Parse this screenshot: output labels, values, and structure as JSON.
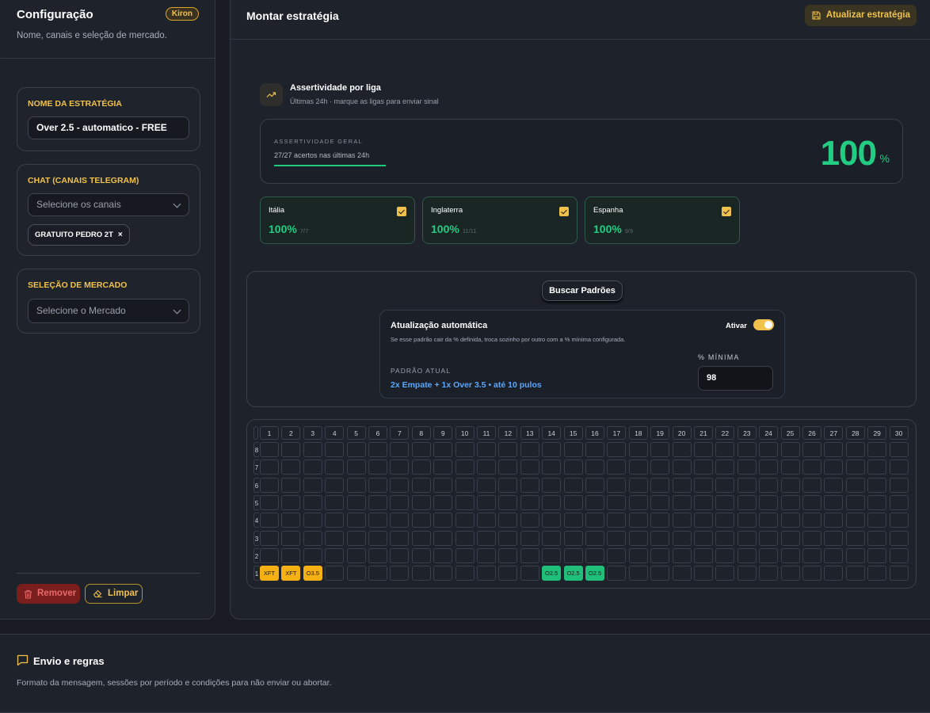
{
  "left": {
    "title": "Configuração",
    "badge": "Kiron",
    "subtitle": "Nome, canais e seleção de mercado.",
    "strategy_name": {
      "label": "NOME DA ESTRATÉGIA",
      "value": "Over 2.5 - automatico - FREE"
    },
    "chat": {
      "label": "CHAT (CANAIS TELEGRAM)",
      "placeholder": "Selecione os canais",
      "chip": "GRATUITO PEDRO 2T",
      "chip_remove": "×"
    },
    "market": {
      "label": "SELEÇÃO DE MERCADO",
      "placeholder": "Selecione o Mercado"
    },
    "remove_label": "Remover",
    "clear_label": "Limpar"
  },
  "right": {
    "title": "Montar estratégia",
    "update_label": "Atualizar estratégia",
    "assertivity": {
      "title": "Assertividade por liga",
      "subtitle": "Últimas 24h · marque as ligas para enviar sinal",
      "overall_label": "ASSERTIVIDADE GERAL",
      "overall_sub": "27/27 acertos nas últimas 24h",
      "overall_value": "100",
      "overall_unit": "%",
      "overall_progress": 1.0
    },
    "leagues": [
      {
        "name": "Itália",
        "pct": "100%",
        "count": "7/7",
        "checked": true
      },
      {
        "name": "Inglaterra",
        "pct": "100%",
        "count": "11/11",
        "checked": true
      },
      {
        "name": "Espanha",
        "pct": "100%",
        "count": "9/9",
        "checked": true
      }
    ],
    "search_label": "Buscar Padrões",
    "auto_update": {
      "title": "Atualização automática",
      "description": "Se esse padrão cair da % definida, troca sozinho por outro com a % mínima configurada.",
      "toggle_label": "Ativar",
      "enabled": true,
      "current_label": "PADRÃO ATUAL",
      "current_value": "2x Empate + 1x Over 3.5 • até 10 pulos",
      "min_label": "% MÍNIMA",
      "min_value": "98"
    },
    "grid": {
      "columns": [
        "1",
        "2",
        "3",
        "4",
        "5",
        "6",
        "7",
        "8",
        "9",
        "10",
        "11",
        "12",
        "13",
        "14",
        "15",
        "16",
        "17",
        "18",
        "19",
        "20",
        "21",
        "22",
        "23",
        "24",
        "25",
        "26",
        "27",
        "28",
        "29",
        "30"
      ],
      "rows": [
        "8",
        "7",
        "6",
        "5",
        "4",
        "3",
        "2",
        "1"
      ],
      "marks": [
        {
          "row": "1",
          "col": "1",
          "text": "XFT",
          "color": "#f5b014"
        },
        {
          "row": "1",
          "col": "2",
          "text": "XFT",
          "color": "#f5b014"
        },
        {
          "row": "1",
          "col": "3",
          "text": "O3.5",
          "color": "#f5b014"
        },
        {
          "row": "1",
          "col": "14",
          "text": "O2.5",
          "color": "#1fbf7a"
        },
        {
          "row": "1",
          "col": "15",
          "text": "O2.5",
          "color": "#1fbf7a"
        },
        {
          "row": "1",
          "col": "16",
          "text": "O2.5",
          "color": "#1fbf7a"
        }
      ]
    }
  },
  "bottom": {
    "title": "Envio e regras",
    "subtitle": "Formato da mensagem, sessões por período e condições para não enviar ou abortar."
  }
}
